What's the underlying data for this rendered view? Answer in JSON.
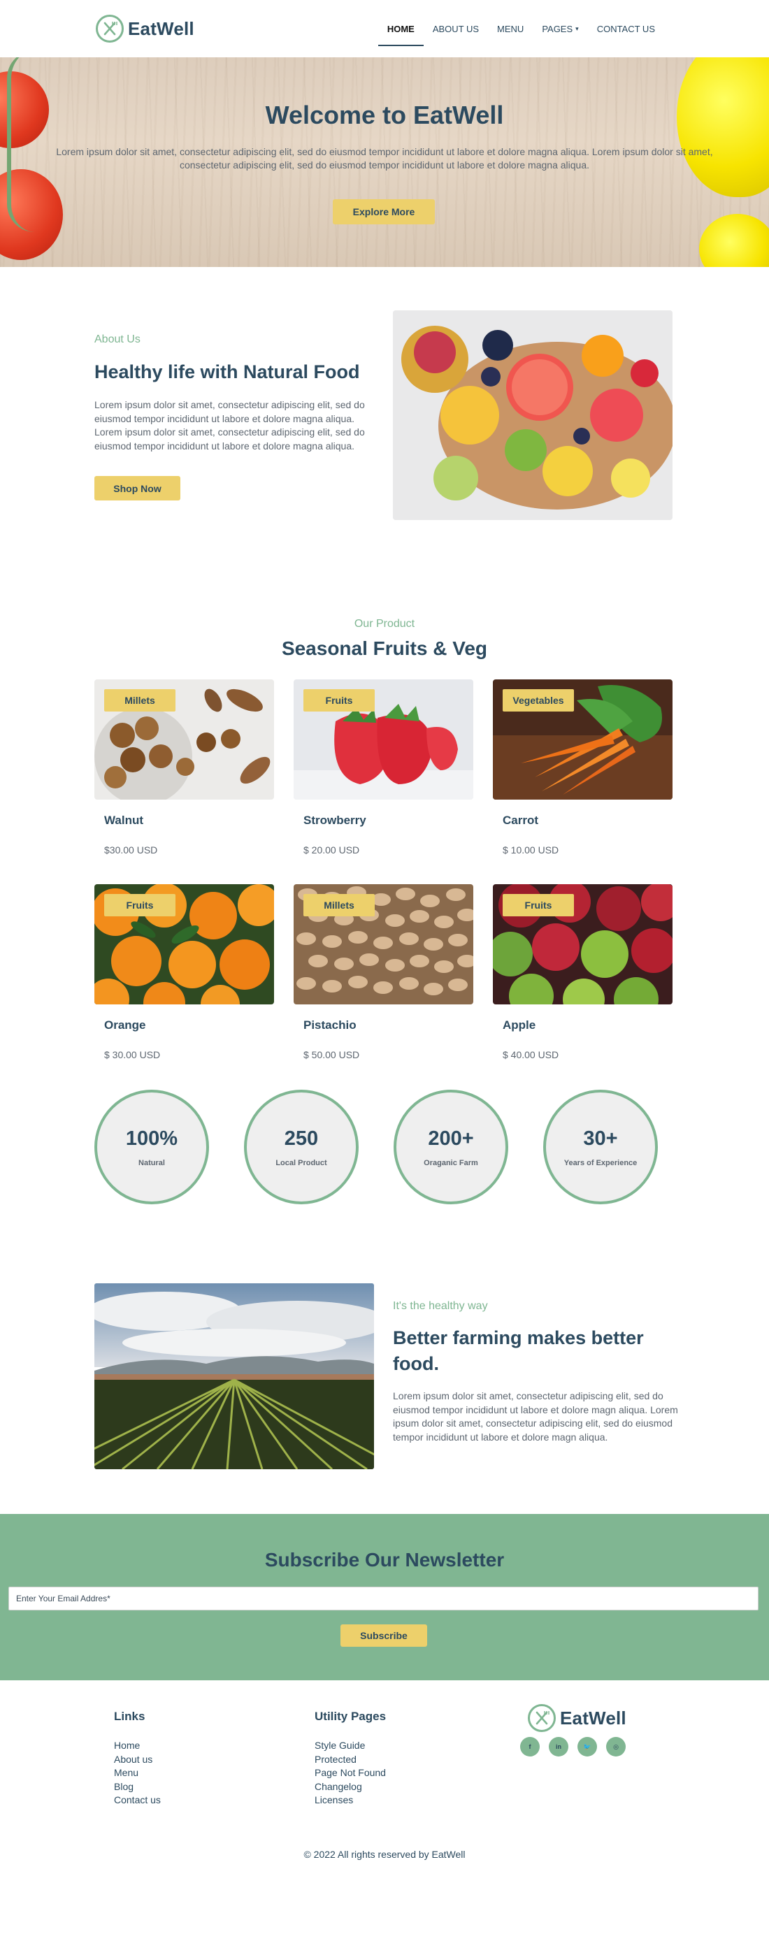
{
  "brand": {
    "name": "EatWell"
  },
  "nav": {
    "items": [
      {
        "label": "HOME",
        "active": true
      },
      {
        "label": "ABOUT US"
      },
      {
        "label": "MENU"
      },
      {
        "label": "PAGES"
      },
      {
        "label": "CONTACT US"
      }
    ],
    "pages_caret": "▾"
  },
  "hero": {
    "title": "Welcome to EatWell",
    "text": "Lorem ipsum dolor sit amet, consectetur adipiscing elit, sed do eiusmod tempor incididunt ut labore et dolore magna aliqua. Lorem ipsum dolor sit amet, consectetur adipiscing elit, sed do eiusmod tempor incididunt ut labore et dolore magna aliqua.",
    "button": "Explore More"
  },
  "about": {
    "eyebrow": "About Us",
    "title": "Healthy life with Natural Food",
    "text": "Lorem ipsum dolor sit amet, consectetur adipiscing elit, sed do eiusmod tempor incididunt ut labore et dolore magna aliqua. Lorem ipsum dolor sit amet, consectetur adipiscing elit, sed do eiusmod tempor incididunt ut labore et dolore magna aliqua.",
    "button": "Shop Now"
  },
  "products": {
    "eyebrow": "Our Product",
    "title": "Seasonal Fruits & Veg",
    "items": [
      {
        "badge": "Millets",
        "name": "Walnut",
        "price": "$30.00 USD"
      },
      {
        "badge": "Fruits",
        "name": "Strowberry",
        "price": "$ 20.00 USD"
      },
      {
        "badge": "Vegetables",
        "name": "Carrot",
        "price": "$ 10.00 USD"
      },
      {
        "badge": "Fruits",
        "name": "Orange",
        "price": "$ 30.00 USD"
      },
      {
        "badge": "Millets",
        "name": "Pistachio",
        "price": "$ 50.00 USD"
      },
      {
        "badge": "Fruits",
        "name": "Apple",
        "price": "$ 40.00 USD"
      }
    ]
  },
  "stats": [
    {
      "value": "100%",
      "label": "Natural"
    },
    {
      "value": "250",
      "label": "Local Product"
    },
    {
      "value": "200+",
      "label": "Oraganic Farm"
    },
    {
      "value": "30+",
      "label": "Years of Experience"
    }
  ],
  "farming": {
    "eyebrow": "It's the healthy way",
    "title": "Better farming makes better food.",
    "text": "Lorem ipsum dolor sit amet, consectetur adipiscing elit, sed do eiusmod tempor incididunt ut labore et dolore magn aliqua. Lorem ipsum dolor sit amet, consectetur adipiscing elit, sed do eiusmod tempor incididunt ut labore et dolore magn aliqua."
  },
  "newsletter": {
    "title": "Subscribe Our Newsletter",
    "placeholder": "Enter Your Email Addres*",
    "button": "Subscribe"
  },
  "footer": {
    "links": {
      "heading": "Links",
      "items": [
        "Home",
        "About us",
        "Menu",
        "Blog",
        "Contact us"
      ]
    },
    "utility": {
      "heading": "Utility Pages",
      "items": [
        "Style Guide",
        "Protected",
        "Page Not Found",
        "Changelog",
        "Licenses"
      ]
    },
    "socials": [
      {
        "icon": "facebook-icon",
        "glyph": "f"
      },
      {
        "icon": "linkedin-icon",
        "glyph": "in"
      },
      {
        "icon": "twitter-icon",
        "glyph": "🐦"
      },
      {
        "icon": "instagram-icon",
        "glyph": "◎"
      }
    ],
    "copyright": "© 2022 All rights reserved by EatWell"
  },
  "colors": {
    "primary_text": "#2c4a5f",
    "accent_green": "#7fb692",
    "button_yellow": "#edd06b",
    "body_text": "#5d6670"
  }
}
